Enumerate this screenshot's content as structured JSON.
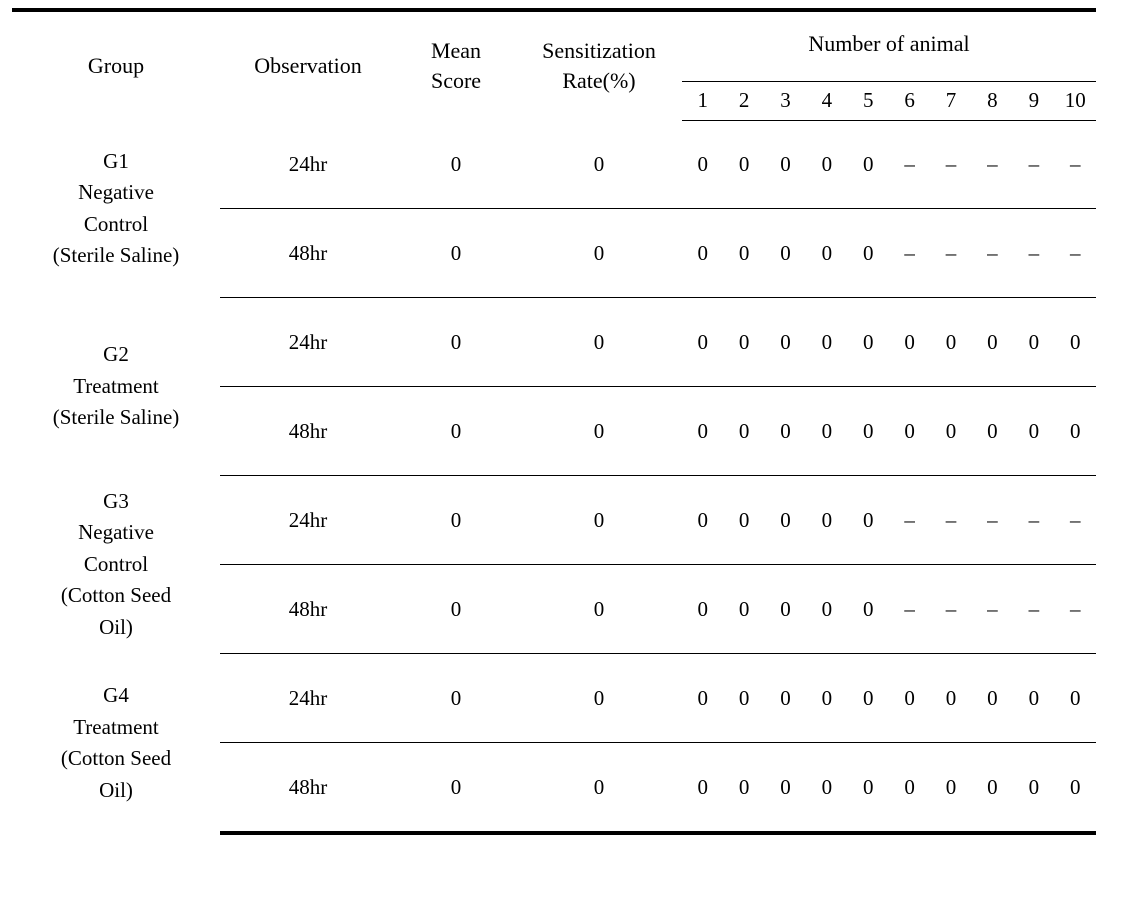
{
  "table": {
    "headers": {
      "group": "Group",
      "observation": "Observation",
      "mean_score_line1": "Mean",
      "mean_score_line2": "Score",
      "sensitization_line1": "Sensitization",
      "sensitization_line2": "Rate(%)",
      "animal_span": "Number of animal",
      "animal_numbers": [
        "1",
        "2",
        "3",
        "4",
        "5",
        "6",
        "7",
        "8",
        "9",
        "10"
      ]
    },
    "groups": [
      {
        "id": "G1",
        "label_lines": [
          "G1",
          "Negative",
          "Control",
          "(Sterile Saline)"
        ],
        "rows": [
          {
            "observation": "24hr",
            "mean_score": "0",
            "sensitization_rate": "0",
            "animals": [
              "0",
              "0",
              "0",
              "0",
              "0",
              "–",
              "–",
              "–",
              "–",
              "–"
            ]
          },
          {
            "observation": "48hr",
            "mean_score": "0",
            "sensitization_rate": "0",
            "animals": [
              "0",
              "0",
              "0",
              "0",
              "0",
              "–",
              "–",
              "–",
              "–",
              "–"
            ]
          }
        ]
      },
      {
        "id": "G2",
        "label_lines": [
          "G2",
          "Treatment",
          "(Sterile Saline)"
        ],
        "rows": [
          {
            "observation": "24hr",
            "mean_score": "0",
            "sensitization_rate": "0",
            "animals": [
              "0",
              "0",
              "0",
              "0",
              "0",
              "0",
              "0",
              "0",
              "0",
              "0"
            ]
          },
          {
            "observation": "48hr",
            "mean_score": "0",
            "sensitization_rate": "0",
            "animals": [
              "0",
              "0",
              "0",
              "0",
              "0",
              "0",
              "0",
              "0",
              "0",
              "0"
            ]
          }
        ]
      },
      {
        "id": "G3",
        "label_lines": [
          "G3",
          "Negative",
          "Control",
          "(Cotton Seed",
          "Oil)"
        ],
        "rows": [
          {
            "observation": "24hr",
            "mean_score": "0",
            "sensitization_rate": "0",
            "animals": [
              "0",
              "0",
              "0",
              "0",
              "0",
              "–",
              "–",
              "–",
              "–",
              "–"
            ]
          },
          {
            "observation": "48hr",
            "mean_score": "0",
            "sensitization_rate": "0",
            "animals": [
              "0",
              "0",
              "0",
              "0",
              "0",
              "–",
              "–",
              "–",
              "–",
              "–"
            ]
          }
        ]
      },
      {
        "id": "G4",
        "label_lines": [
          "G4",
          "Treatment",
          "(Cotton Seed",
          "Oil)"
        ],
        "rows": [
          {
            "observation": "24hr",
            "mean_score": "0",
            "sensitization_rate": "0",
            "animals": [
              "0",
              "0",
              "0",
              "0",
              "0",
              "0",
              "0",
              "0",
              "0",
              "0"
            ]
          },
          {
            "observation": "48hr",
            "mean_score": "0",
            "sensitization_rate": "0",
            "animals": [
              "0",
              "0",
              "0",
              "0",
              "0",
              "0",
              "0",
              "0",
              "0",
              "0"
            ]
          }
        ]
      }
    ]
  }
}
